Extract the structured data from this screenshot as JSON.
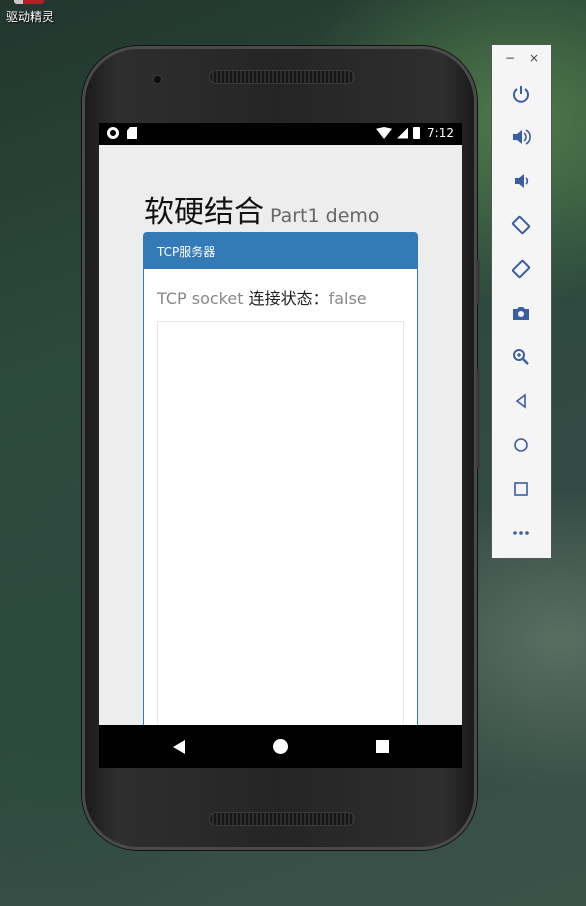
{
  "desktop": {
    "icon_label": "驱动精灵"
  },
  "phone": {
    "statusbar": {
      "time": "7:12"
    },
    "app": {
      "title": "软硬结合",
      "subtitle": "Part1 demo",
      "panel": {
        "header": "TCP服务器",
        "status_prefix": "TCP socket ",
        "status_label": "连接状态：",
        "status_value": "false"
      }
    },
    "navbar": {
      "back": "back-icon",
      "home": "home-icon",
      "recents": "recents-icon"
    }
  },
  "toolbar": {
    "minimize": "−",
    "close": "×",
    "buttons": [
      "power-icon",
      "volume-up-icon",
      "volume-down-icon",
      "rotate-left-icon",
      "rotate-right-icon",
      "camera-icon",
      "zoom-icon",
      "back-icon",
      "home-icon",
      "overview-icon",
      "more-icon"
    ],
    "accent": "#3a5fa0"
  },
  "colors": {
    "panel_primary": "#337ab7",
    "page_bg": "#ededed"
  }
}
